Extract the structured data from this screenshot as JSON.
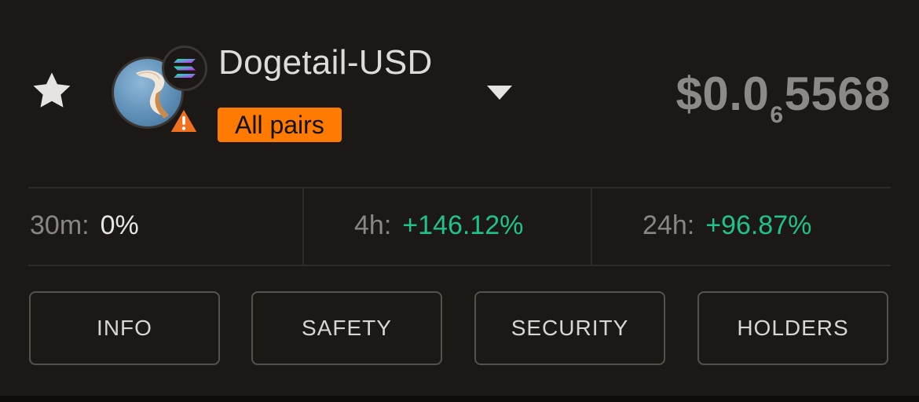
{
  "header": {
    "pair_name": "Dogetail-USD",
    "pairs_badge": "All pairs",
    "price": {
      "prefix": "$0.0",
      "zero_count": "6",
      "digits": "5568"
    },
    "chain_icon": "solana-icon",
    "warning_icon": "warning-triangle-icon",
    "favorite_icon": "star-icon",
    "dropdown_icon": "caret-down-icon"
  },
  "stats": [
    {
      "label": "30m:",
      "value": "0%",
      "trend": "neutral"
    },
    {
      "label": "4h:",
      "value": "+146.12%",
      "trend": "up"
    },
    {
      "label": "24h:",
      "value": "+96.87%",
      "trend": "up"
    }
  ],
  "tabs": [
    {
      "label": "INFO"
    },
    {
      "label": "SAFETY"
    },
    {
      "label": "SECURITY"
    },
    {
      "label": "HOLDERS"
    }
  ],
  "colors": {
    "background": "#1b1816",
    "accent_orange": "#ff7a00",
    "positive_green": "#1fc38a",
    "muted_text": "#8a8684"
  }
}
